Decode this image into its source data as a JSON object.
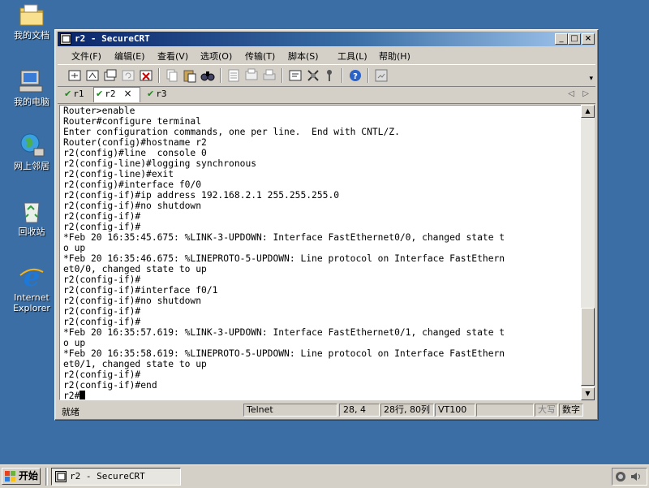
{
  "desktop": {
    "icons": [
      {
        "label": "我的文档"
      },
      {
        "label": "我的电脑"
      },
      {
        "label": "网上邻居"
      },
      {
        "label": "回收站"
      },
      {
        "label": "Internet Explorer"
      }
    ]
  },
  "window": {
    "title": "r2 - SecureCRT",
    "controls": {
      "minimize": "_",
      "maximize": "□",
      "close": "×"
    }
  },
  "menu": [
    {
      "label": "文件(F)"
    },
    {
      "label": "编辑(E)"
    },
    {
      "label": "查看(V)"
    },
    {
      "label": "选项(O)"
    },
    {
      "label": "传输(T)"
    },
    {
      "label": "脚本(S)"
    },
    {
      "label": "工具(L)"
    },
    {
      "label": "帮助(H)"
    }
  ],
  "tabs": [
    {
      "label": "r1",
      "active": false
    },
    {
      "label": "r2",
      "active": true
    },
    {
      "label": "r3",
      "active": false
    }
  ],
  "tab_check": "✔",
  "tab_close": "×",
  "tab_nav": {
    "left": "◁",
    "right": "▷"
  },
  "terminal": {
    "lines": [
      "Router>enable",
      "Router#configure terminal",
      "Enter configuration commands, one per line.  End with CNTL/Z.",
      "Router(config)#hostname r2",
      "r2(config)#line  console 0",
      "r2(config-line)#logging synchronous",
      "r2(config-line)#exit",
      "r2(config)#interface f0/0",
      "r2(config-if)#ip address 192.168.2.1 255.255.255.0",
      "r2(config-if)#no shutdown",
      "r2(config-if)#",
      "r2(config-if)#",
      "*Feb 20 16:35:45.675: %LINK-3-UPDOWN: Interface FastEthernet0/0, changed state t",
      "o up",
      "*Feb 20 16:35:46.675: %LINEPROTO-5-UPDOWN: Line protocol on Interface FastEthern",
      "et0/0, changed state to up",
      "r2(config-if)#",
      "r2(config-if)#interface f0/1",
      "r2(config-if)#no shutdown",
      "r2(config-if)#",
      "r2(config-if)#",
      "*Feb 20 16:35:57.619: %LINK-3-UPDOWN: Interface FastEthernet0/1, changed state t",
      "o up",
      "*Feb 20 16:35:58.619: %LINEPROTO-5-UPDOWN: Line protocol on Interface FastEthern",
      "et0/1, changed state to up",
      "r2(config-if)#",
      "r2(config-if)#end"
    ],
    "prompt": "r2#"
  },
  "status": {
    "ready": "就绪",
    "protocol": "Telnet",
    "cursor_pos": "28,  4",
    "size": "28行, 80列",
    "emulation": "VT100",
    "caps": "大写",
    "num": "数字"
  },
  "taskbar": {
    "start_label": "开始",
    "task_label": "r2 - SecureCRT"
  }
}
